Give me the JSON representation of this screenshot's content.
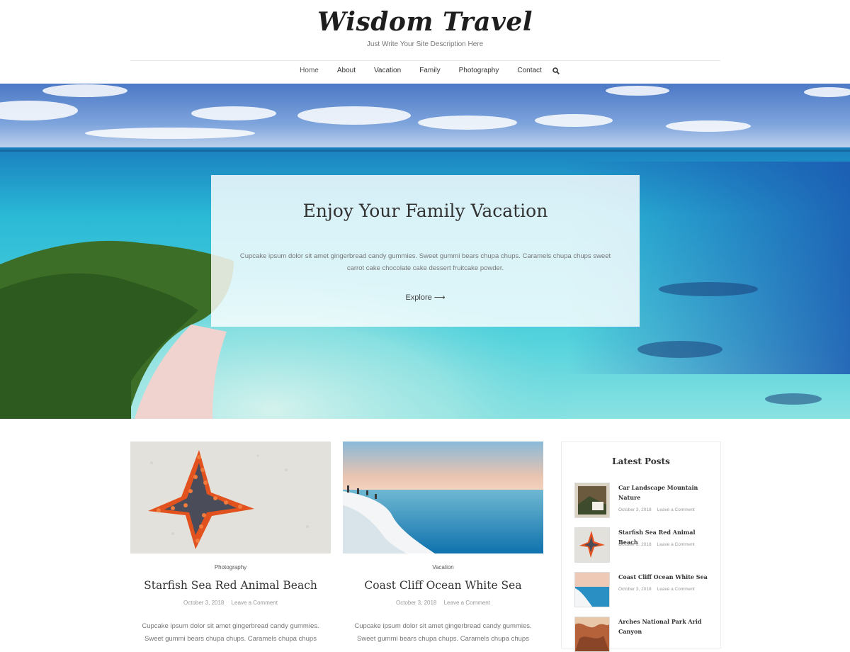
{
  "site": {
    "title": "Wisdom Travel",
    "description": "Just Write Your Site Description Here"
  },
  "nav": {
    "items": [
      "Home",
      "About",
      "Vacation",
      "Family",
      "Photography",
      "Contact"
    ],
    "search_icon": "search-icon"
  },
  "hero": {
    "title": "Enjoy Your Family Vacation",
    "text": "Cupcake ipsum dolor sit amet gingerbread candy gummies. Sweet gummi bears chupa chups. Caramels chupa chups sweet carrot cake chocolate cake dessert fruitcake powder.",
    "button": "Explore ⟶"
  },
  "posts": [
    {
      "category": "Photography",
      "title": "Starfish Sea Red Animal Beach",
      "date": "October 3, 2018",
      "comments": "Leave a Comment",
      "excerpt": "Cupcake ipsum dolor sit amet gingerbread candy gummies. Sweet gummi bears chupa chups. Caramels chupa chups"
    },
    {
      "category": "Vacation",
      "title": "Coast Cliff Ocean White Sea",
      "date": "October 3, 2018",
      "comments": "Leave a Comment",
      "excerpt": "Cupcake ipsum dolor sit amet gingerbread candy gummies. Sweet gummi bears chupa chups. Caramels chupa chups"
    }
  ],
  "sidebar": {
    "heading": "Latest Posts",
    "items": [
      {
        "title": "Car Landscape Mountain Nature",
        "date": "October 3, 2018",
        "comments": "Leave a Comment"
      },
      {
        "title": "Starfish Sea Red Animal Beach",
        "date": "October 3, 2018",
        "comments": "Leave a Comment"
      },
      {
        "title": "Coast Cliff Ocean White Sea",
        "date": "October 3, 2018",
        "comments": "Leave a Comment"
      },
      {
        "title": "Arches National Park Arid Canyon",
        "date": "",
        "comments": ""
      }
    ]
  },
  "colors": {
    "text": "#333333",
    "muted": "#777777",
    "sea": "#4cc9d8",
    "deep_sea": "#1e5fb8"
  }
}
